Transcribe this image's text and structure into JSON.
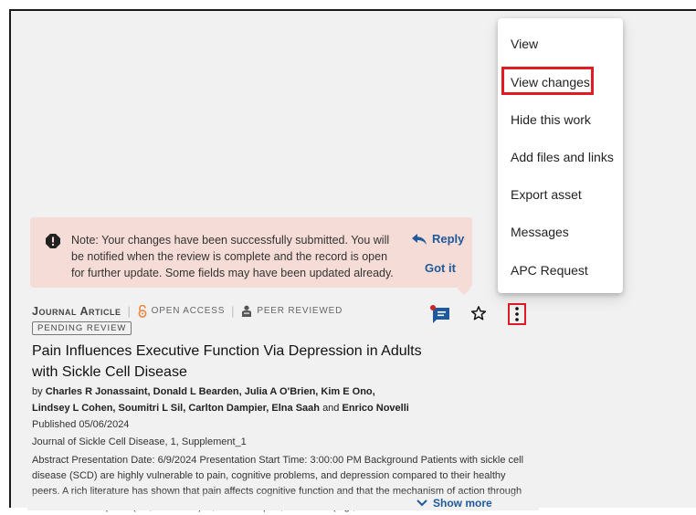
{
  "menu": {
    "items": [
      {
        "label": "View"
      },
      {
        "label": "View changes"
      },
      {
        "label": "Hide this work"
      },
      {
        "label": "Add files and links"
      },
      {
        "label": "Export asset"
      },
      {
        "label": "Messages"
      },
      {
        "label": "APC Request"
      }
    ]
  },
  "note": {
    "text": "Note: Your changes have been successfully submitted. You will be notified when the review is complete and the record is open for further update. Some fields may have been updated already.",
    "reply_label": "Reply",
    "gotit_label": "Got it"
  },
  "record": {
    "kind": "Journal Article",
    "access": "OPEN ACCESS",
    "review": "PEER REVIEWED",
    "status_badge": "PENDING REVIEW",
    "title": "Pain Influences Executive Function Via Depression in Adults with Sickle Cell Disease",
    "authors_prefix": "by",
    "authors": "Charles R Jonassaint, Donald L Bearden, Julia A O'Brien, Kim E Ono, Lindsey L Cohen, Soumitri L Sil, Carlton Dampier, Elna Saah",
    "authors_joiner": "and",
    "authors_last": "Enrico Novelli",
    "published": "Published 05/06/2024",
    "journal": "Journal of Sickle Cell Disease, 1, Supplement_1",
    "abstract": "Abstract Presentation Date: 6/9/2024 Presentation Start Time: 3:00:00 PM Background Patients with sickle cell disease (SCD) are highly vulnerable to pain, cognitive problems, and depression compared to their healthy peers. A rich literature has shown that pain affects cognitive function and that the mechanism of action through which this takes place (i.e., mediation) is, at least in part, emotional (e.g.,",
    "show_more": "Show more"
  },
  "icons": {
    "note": "alert-octagon-icon",
    "reply": "reply-arrow-icon",
    "open_access": "open-lock-icon",
    "peer_reviewed": "peer-review-icon",
    "messages": "chat-bubble-icon",
    "favorite": "star-outline-icon",
    "more": "kebab-menu-icon",
    "show_more": "chevron-down-icon"
  },
  "colors": {
    "accent": "#1e5a9b",
    "highlight": "#e01b24",
    "note_bg": "#f6dcd6",
    "open_access": "#e8843c",
    "unread_dot": "#c62828"
  }
}
